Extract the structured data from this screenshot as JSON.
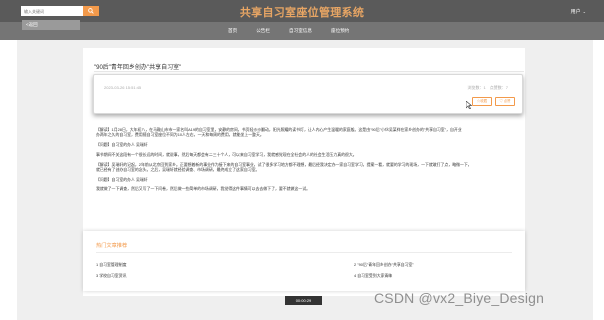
{
  "header": {
    "search_placeholder": "输入关键词",
    "site_title": "共享自习室座位管理系统",
    "user_label": "用户",
    "user_caret": "⌄"
  },
  "nav": {
    "back_label": "<返回",
    "links": [
      "首页",
      "公告栏",
      "自习室信息",
      "座位预约"
    ]
  },
  "post": {
    "title": "\"90后\"青年回乡创办\"共享自习室\"",
    "date": "2023-03-26 15:51:45",
    "stats": "浏览数：1　点赞数：7",
    "collect_label": "☆收藏",
    "like_label": "♡ 点赞",
    "paragraphs": [
      "【解读】1月28日，大年初八，在马鞍山市市一家名叫A19的自习室里，安静的房间，书页轻沙沙翻动，阳光照耀的读书灯，让人内心产生温暖的家庭般。这是由\"90后\"小伙吴某祥在家乡创办的\"共享自习室\"，自开业",
      "办两年之久的自习室，费用随自习室座位不同为10人左右，一天和每周的费用，就能坐上一整天。",
      "",
      "【问题】自习室的办人 吴瑞轩",
      "",
      "事节期间不关这段有一个很长远的时间，就说事，然后每天都会有二三十个人，可以来自习室学习，我就感觉现在全社会的人的社会生活压力真的很大。",
      "",
      "【解读】吴瑞轩的记起，2年前从北京回到家乡。正要想着新的事业作为接下来的自习室事业，试了很多学习地方都不理想，最后经我决定办一家自习室学习，提案一看，就要的学习的现场，一下就敢打了点，略微一下，",
      "就已经有了创办自习室的念头。之后，吴瑞轩就经验调查、市场调研，最终成立了这家自习室。",
      "",
      "【问题】自习室的办人 吴瑞轩",
      "",
      "我就做了一下调查，然后又写了一下问卷，然后做一些简单的市场调研，我觉得这件事情可以去去做下了，要不就做这一试。"
    ]
  },
  "hot": {
    "title": "热门文章推荐",
    "items": [
      "1 自习室管理制度",
      "2 \"90后\"青年回乡创办\"共享自习室\"",
      "3 学校自习室资讯",
      "4 自习室受到大家青睐"
    ]
  },
  "footer": {
    "badge": "00:00:29"
  },
  "watermark": "CSDN @vx2_Biye_Design",
  "colors": {
    "topbar": "#5a5a5a",
    "navbar": "#757575",
    "accent": "#f39a4b",
    "title": "#e7a564"
  }
}
